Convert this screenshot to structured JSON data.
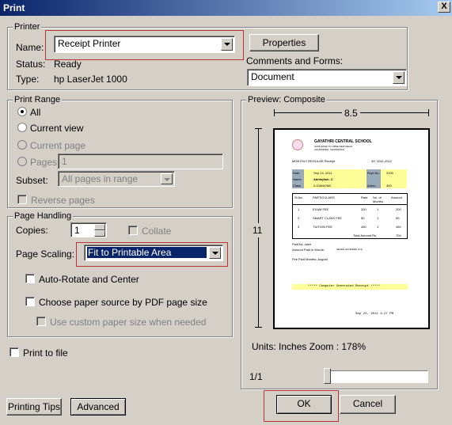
{
  "window": {
    "title": "Print",
    "close": "X"
  },
  "printer": {
    "legend": "Printer",
    "name_label": "Name:",
    "name_value": "Receipt Printer",
    "properties": "Properties",
    "status_label": "Status:",
    "status_value": "Ready",
    "type_label": "Type:",
    "type_value": "hp LaserJet 1000",
    "comments_label": "Comments and Forms:",
    "comments_value": "Document"
  },
  "range": {
    "legend": "Print Range",
    "all": "All",
    "current_view": "Current view",
    "current_page": "Current page",
    "pages": "Pages",
    "pages_value": "1",
    "subset_label": "Subset:",
    "subset_value": "All pages in range",
    "reverse": "Reverse pages"
  },
  "handling": {
    "legend": "Page Handling",
    "copies_label": "Copies:",
    "copies_value": "1",
    "collate": "Collate",
    "scaling_label": "Page Scaling:",
    "scaling_value": "Fit to Printable Area",
    "auto_rotate": "Auto-Rotate and Center",
    "choose_source": "Choose paper source by PDF page size",
    "custom_size": "Use custom paper size when needed"
  },
  "print_to_file": "Print to file",
  "preview": {
    "legend": "Preview: Composite",
    "width": "8.5",
    "height": "11",
    "units": "Units: Inches Zoom : 178%",
    "page": "1/1"
  },
  "receipt": {
    "school": "GAYATHRI CENTRAL SCHOOL",
    "sub1": "AFFILIATED TO CBSE NEW DELHI",
    "sub2": "CHUDDINDU, CHUDDINDU.",
    "monthly": "MONTHLY REGULAR Receipt",
    "ay": "AY: 2011-2012",
    "date_l": "Date",
    "date_v": "Sep 24, 2011",
    "receipt_l": "Rcpt No.",
    "receipt_v": "2200",
    "name_l": "Name",
    "name_v": "Abhinjtish. C",
    "class_l": "Class",
    "class_v": "II-DIAMOND",
    "admn_l": "Admn.",
    "admn_v": "300",
    "th": [
      "Sl.No.",
      "PARTICULARS",
      "Rate",
      "No. of Months",
      "Amount"
    ],
    "rows": [
      [
        "1",
        "EXAM FEE",
        "200",
        "1",
        "200"
      ],
      [
        "2",
        "SMART CLASS FEE",
        "50",
        "1",
        "50"
      ],
      [
        "3",
        "TUITION FEE",
        "450",
        "1",
        "450"
      ]
    ],
    "total_l": "Total Amount Rs.",
    "total_v": "700",
    "paid_by": "Paid by: cash",
    "words": "Amount Paid in Words:",
    "words_v": "SEVEN HUNDRED Only",
    "months": "Fee Paid Months: August",
    "computer": "***** Computer Generated Receipt *****",
    "stamp": "Sep 24, 2011 4:27 PM"
  },
  "buttons": {
    "tips": "Printing Tips",
    "advanced": "Advanced",
    "ok": "OK",
    "cancel": "Cancel"
  }
}
